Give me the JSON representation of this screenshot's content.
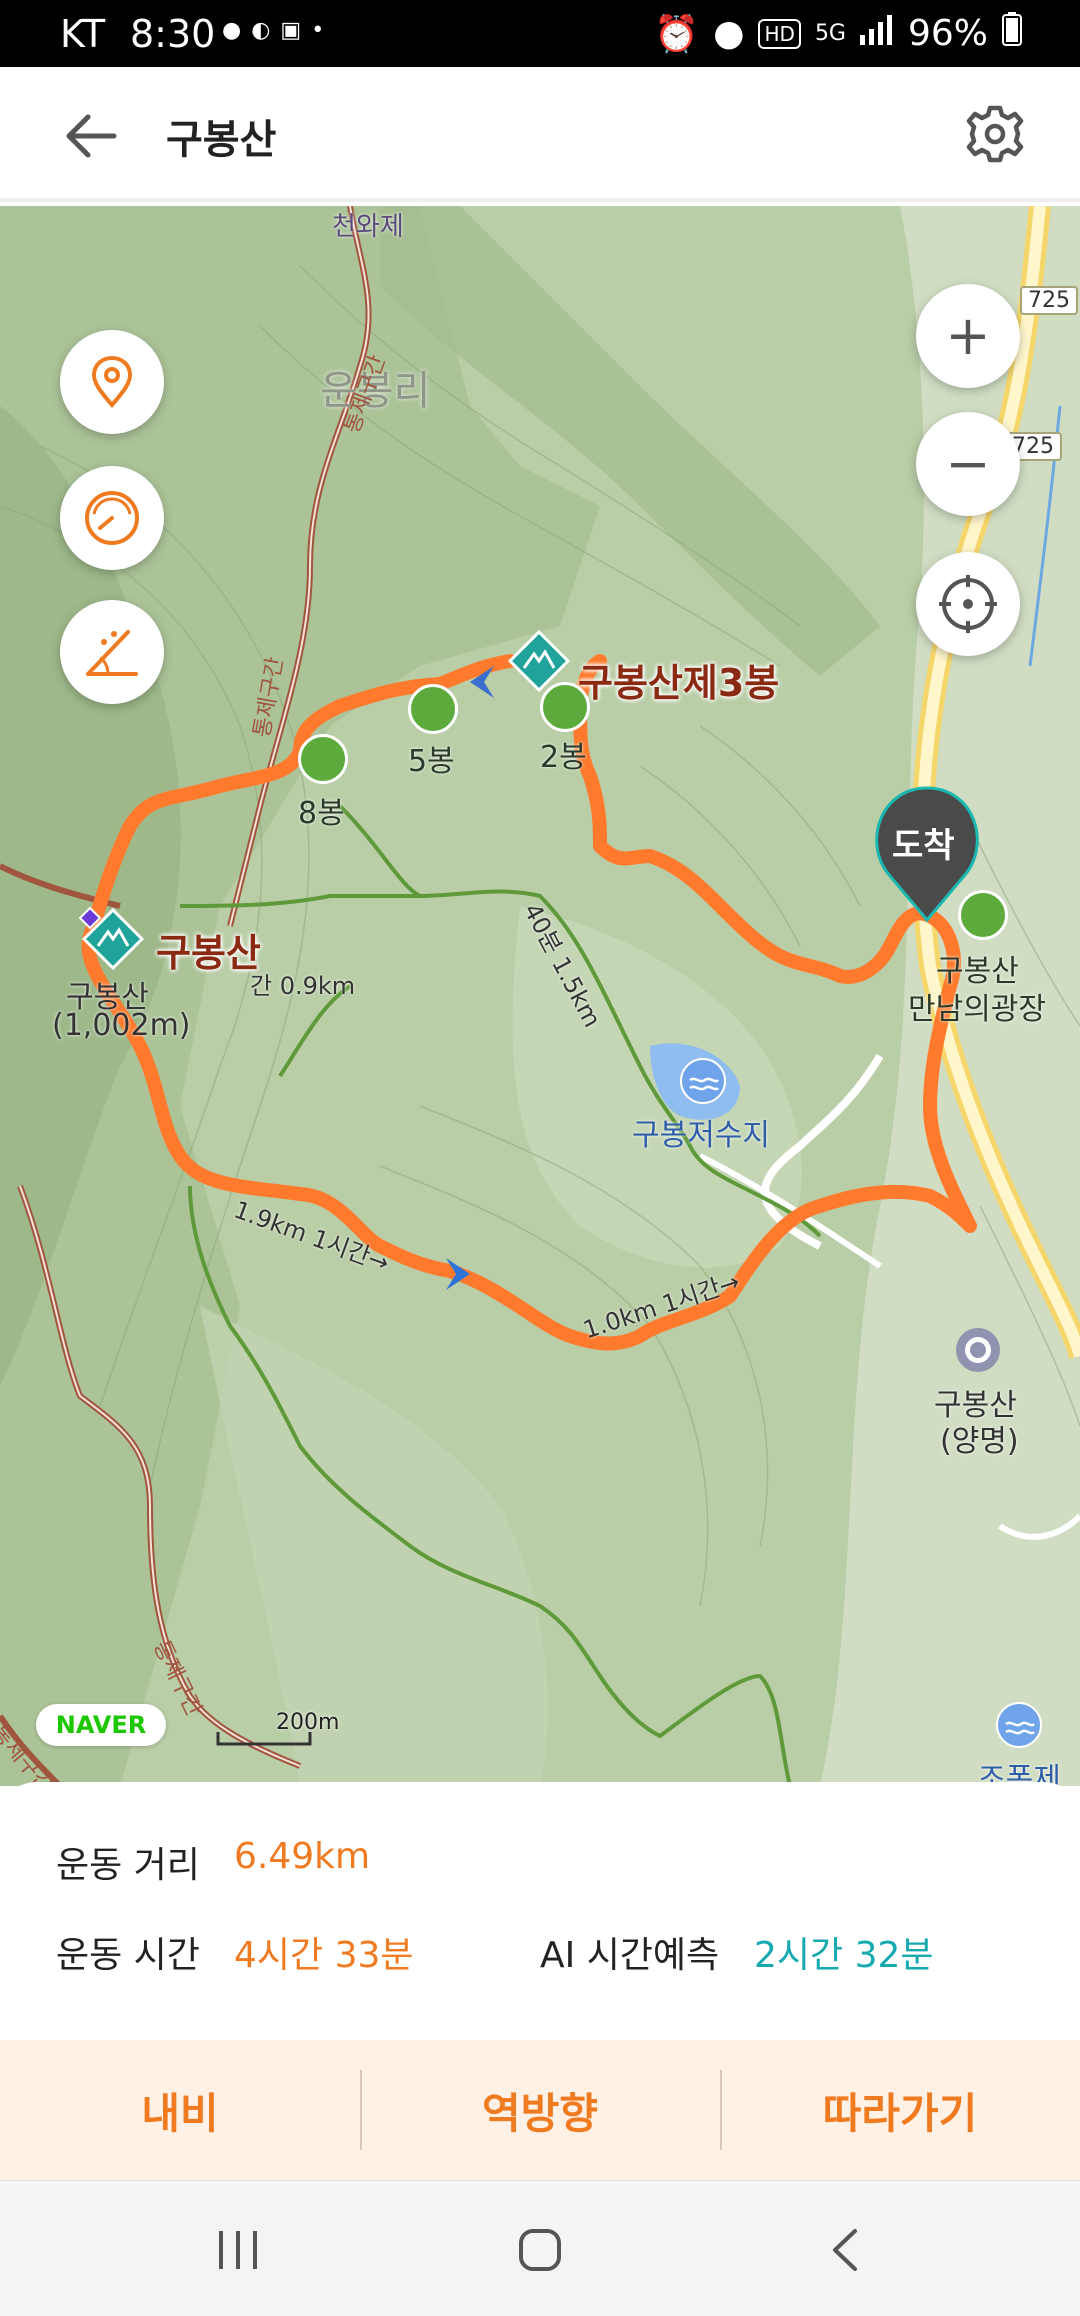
{
  "status_bar": {
    "carrier": "KT",
    "time": "8:30",
    "network": "5G",
    "hd": "HD",
    "battery": "96%"
  },
  "header": {
    "title": "구봉산",
    "back_icon": "arrow-left-icon",
    "settings_icon": "gear-icon"
  },
  "map": {
    "labels": {
      "village": "운봉리",
      "temple": "천와제",
      "ridge_route_1": "통제구간",
      "ridge_route_2": "통제구간",
      "ridge_route_3": "통제구간",
      "ridge_route_4": "통제구간",
      "peak_main": "구봉산",
      "peak_main_elev_name": "구봉산",
      "peak_main_elev": "(1,002m)",
      "peak_third": "구봉산제3봉",
      "peak_5": "5봉",
      "peak_8": "8봉",
      "peak_2": "2봉",
      "trail_time_1": "40분 1.5km",
      "trail_time_2": "간 0.9km",
      "trail_time_3": "1.9km 1시간→",
      "trail_time_4": "1.0km 1시간→",
      "reservoir": "구봉저수지",
      "plaza_line1": "구봉산",
      "plaza_line2": "만남의광장",
      "bus_stop_line1": "구봉산",
      "bus_stop_line2": "(양명)",
      "lake_right": "조폭제",
      "road_number_1": "725",
      "road_number_2": "725",
      "arrival_marker": "도착",
      "scale": "200m",
      "brand": "NAVER"
    },
    "controls": {
      "location_icon": "location-pin-icon",
      "speed_icon": "speedometer-icon",
      "slope_icon": "slope-angle-icon",
      "zoom_in": "+",
      "zoom_out": "−",
      "recenter_icon": "crosshair-icon"
    }
  },
  "stats": {
    "distance_label": "운동 거리",
    "distance_value": "6.49km",
    "time_label": "운동 시간",
    "time_value": "4시간 33분",
    "ai_label": "AI 시간예측",
    "ai_value": "2시간 32분"
  },
  "actions": {
    "navi": "내비",
    "reverse": "역방향",
    "follow": "따라가기"
  },
  "colors": {
    "accent": "#f07a20",
    "teal": "#16a9b0",
    "route": "#ff7a2c"
  }
}
